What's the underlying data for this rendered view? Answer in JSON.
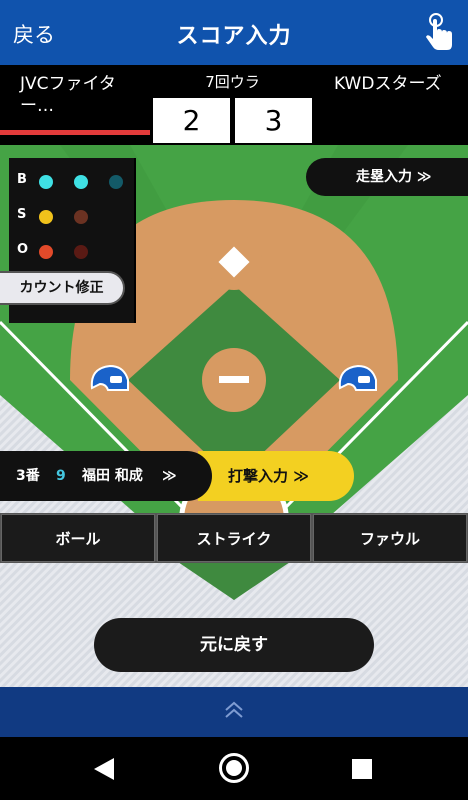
{
  "header": {
    "back_label": "戻る",
    "title": "スコア入力",
    "tap_icon": "tap-hand-icon"
  },
  "scoreboard": {
    "home_team": "JVCファイター…",
    "away_team": "KWDスターズ",
    "inning": "7回ウラ",
    "home_score": "2",
    "away_score": "3",
    "home_team_color": "#e33b3b"
  },
  "count": {
    "labels": {
      "ball": "B",
      "strike": "S",
      "out": "O"
    },
    "balls": 2,
    "strikes": 1,
    "outs": 1,
    "colors": {
      "ball_on": "#3fe0e4",
      "ball_off": "#135a68",
      "strike_on": "#f1c21b",
      "strike_off": "#6b3222",
      "out_on": "#e24a2a",
      "out_off": "#5a1a14"
    },
    "correct_button": "カウント修正"
  },
  "runner_button": "走塁入力 ≫",
  "batter": {
    "order": "3番",
    "number": "9",
    "name": "福田 和成",
    "arrow": "≫"
  },
  "hit_button": "打撃入力 ≫",
  "actions": [
    "ボール",
    "ストライク",
    "ファウル"
  ],
  "undo_button": "元に戻す",
  "drawer_icon": "double-chevron-up-icon",
  "colors": {
    "header_bg": "#1053ad",
    "grass": "#4caa4c",
    "infield_dirt": "#d79a62",
    "helmet": "#1a62c9",
    "accent_yellow": "#f3d021",
    "drawer_bg": "#113a82"
  }
}
